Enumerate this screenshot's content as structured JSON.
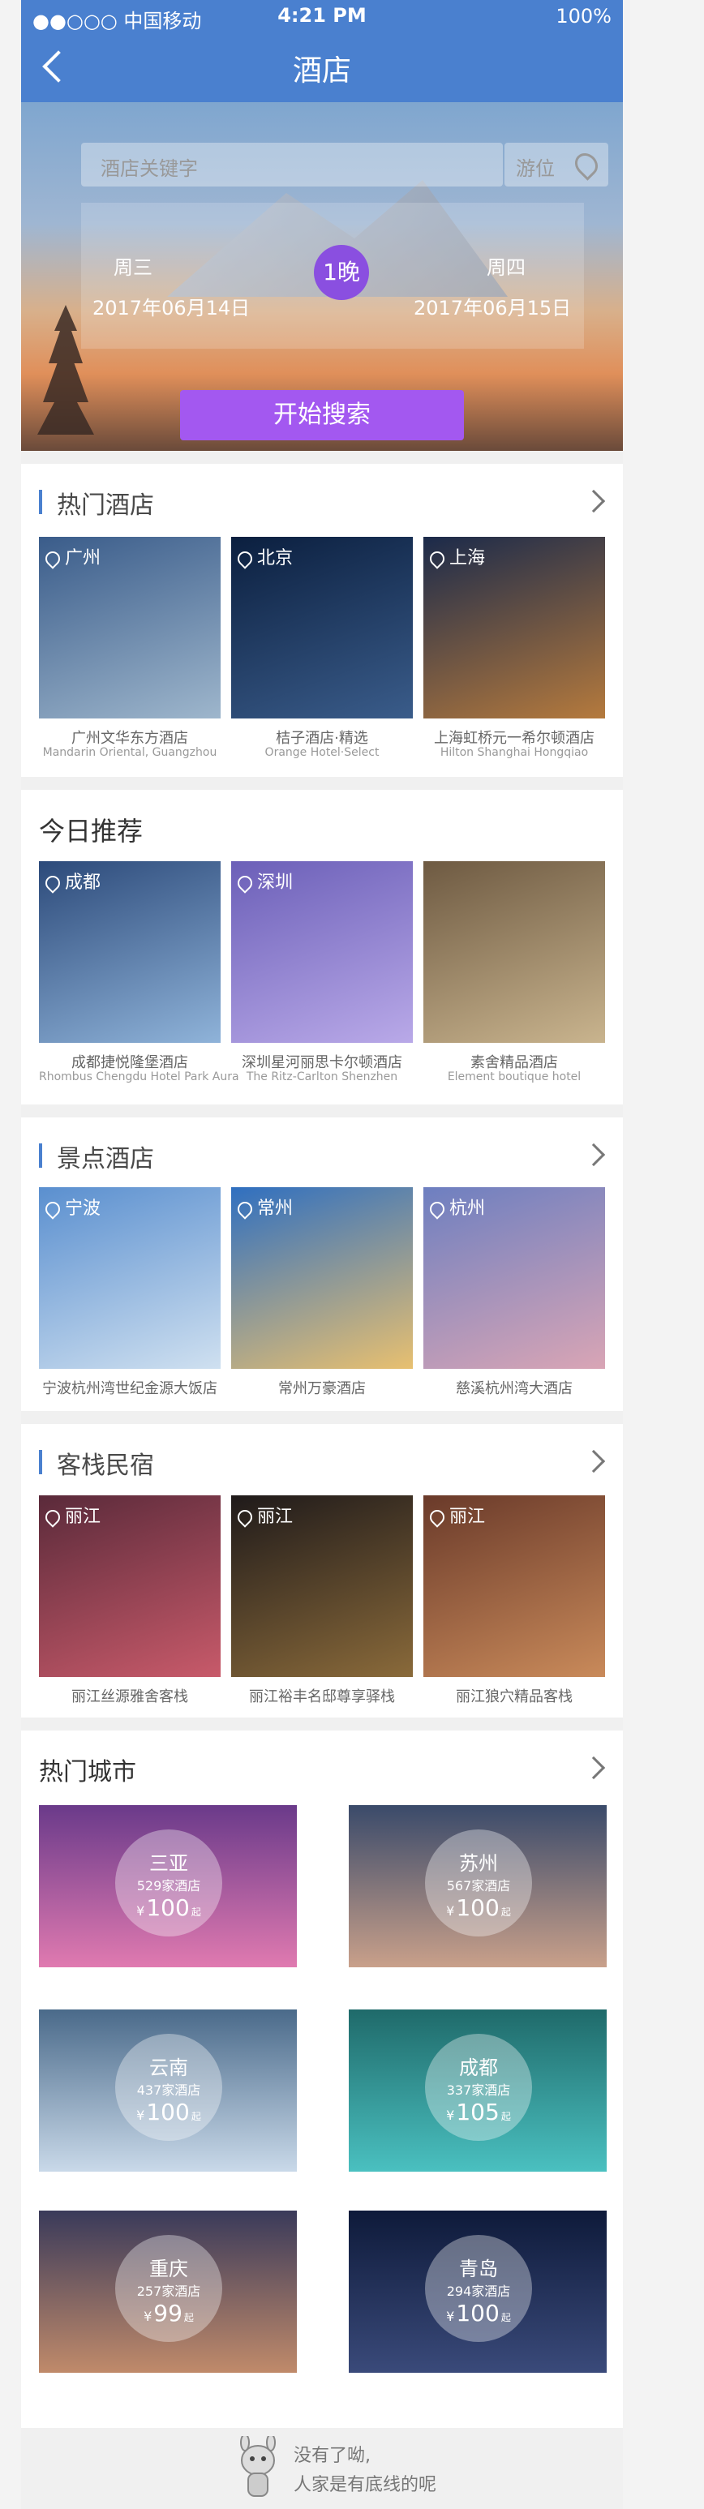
{
  "status_bar": {
    "left": "●●○○○ 中国移动",
    "time": "4:21 PM",
    "battery": "100%"
  },
  "header": {
    "title": "酒店"
  },
  "search": {
    "keyword_placeholder": "酒店关键字",
    "location": "游位",
    "checkin_weekday": "周三",
    "checkout_weekday": "周四",
    "checkin_date": "2017年06月14日",
    "checkout_date": "2017年06月15日",
    "nights": "1晚",
    "button": "开始搜索"
  },
  "hot_hotels": {
    "title": "热门酒店",
    "items": [
      {
        "city": "广州",
        "name": "广州文华东方酒店",
        "sub": "Mandarin Oriental, Guangzhou",
        "colors": [
          "#3a5c8a",
          "#9eb6cc"
        ]
      },
      {
        "city": "北京",
        "name": "桔子酒店·精选",
        "sub": "Orange Hotel·Select",
        "colors": [
          "#0b1f3f",
          "#3a5c8a"
        ]
      },
      {
        "city": "上海",
        "name": "上海虹桥元一希尔顿酒店",
        "sub": "Hilton Shanghai Hongqiao",
        "colors": [
          "#1b2a4a",
          "#b57a3d"
        ]
      }
    ]
  },
  "today": {
    "title": "今日推荐",
    "items": [
      {
        "city": "成都",
        "name": "成都捷悦隆堡酒店",
        "sub": "Rhombus Chengdu Hotel Park Aura",
        "colors": [
          "#2c4a7a",
          "#8fb3d9"
        ]
      },
      {
        "city": "深圳",
        "name": "深圳星河丽思卡尔顿酒店",
        "sub": "The Ritz-Carlton Shenzhen",
        "colors": [
          "#6b5fb8",
          "#b9a9e8"
        ]
      },
      {
        "city": "",
        "name": "素舍精品酒店",
        "sub": "Element boutique hotel",
        "colors": [
          "#6e5a42",
          "#c9b48e"
        ]
      }
    ]
  },
  "scenic": {
    "title": "景点酒店",
    "items": [
      {
        "city": "宁波",
        "name": "宁波杭州湾世纪金源大饭店",
        "colors": [
          "#5a8fcf",
          "#cfe0f0"
        ]
      },
      {
        "city": "常州",
        "name": "常州万豪酒店",
        "colors": [
          "#2f6fc0",
          "#e8c070"
        ]
      },
      {
        "city": "杭州",
        "name": "慈溪杭州湾大酒店",
        "colors": [
          "#6d7fc0",
          "#d9a5b5"
        ]
      }
    ]
  },
  "inn": {
    "title": "客栈民宿",
    "items": [
      {
        "city": "丽江",
        "name": "丽江丝源雅舍客栈",
        "colors": [
          "#5a2a3a",
          "#c85a6a"
        ]
      },
      {
        "city": "丽江",
        "name": "丽江裕丰名邸尊享驿栈",
        "colors": [
          "#1f1a1a",
          "#8a6a3a"
        ]
      },
      {
        "city": "丽江",
        "name": "丽江狼穴精品客栈",
        "colors": [
          "#6a3a2a",
          "#c98a5a"
        ]
      }
    ]
  },
  "hot_cities": {
    "title": "热门城市",
    "items": [
      {
        "name": "三亚",
        "count": "529家酒店",
        "price": "100",
        "currency": "¥",
        "unit": "起",
        "colors": [
          "#6a3a8a",
          "#e07ab0"
        ]
      },
      {
        "name": "苏州",
        "count": "567家酒店",
        "price": "100",
        "currency": "¥",
        "unit": "起",
        "colors": [
          "#3a4a6a",
          "#c9a08a"
        ]
      },
      {
        "name": "云南",
        "count": "437家酒店",
        "price": "100",
        "currency": "¥",
        "unit": "起",
        "colors": [
          "#4a6a8a",
          "#c9d9e9"
        ]
      },
      {
        "name": "成都",
        "count": "337家酒店",
        "price": "105",
        "currency": "¥",
        "unit": "起",
        "colors": [
          "#1f6a6a",
          "#4ac0c0"
        ]
      },
      {
        "name": "重庆",
        "count": "257家酒店",
        "price": "99",
        "currency": "¥",
        "unit": "起",
        "colors": [
          "#3a3a5a",
          "#c08a6a"
        ]
      },
      {
        "name": "青岛",
        "count": "294家酒店",
        "price": "100",
        "currency": "¥",
        "unit": "起",
        "colors": [
          "#0e1a3a",
          "#3a4a7a"
        ]
      }
    ]
  },
  "footer": {
    "line1": "没有了呦,",
    "line2": "人家是有底线的呢"
  }
}
